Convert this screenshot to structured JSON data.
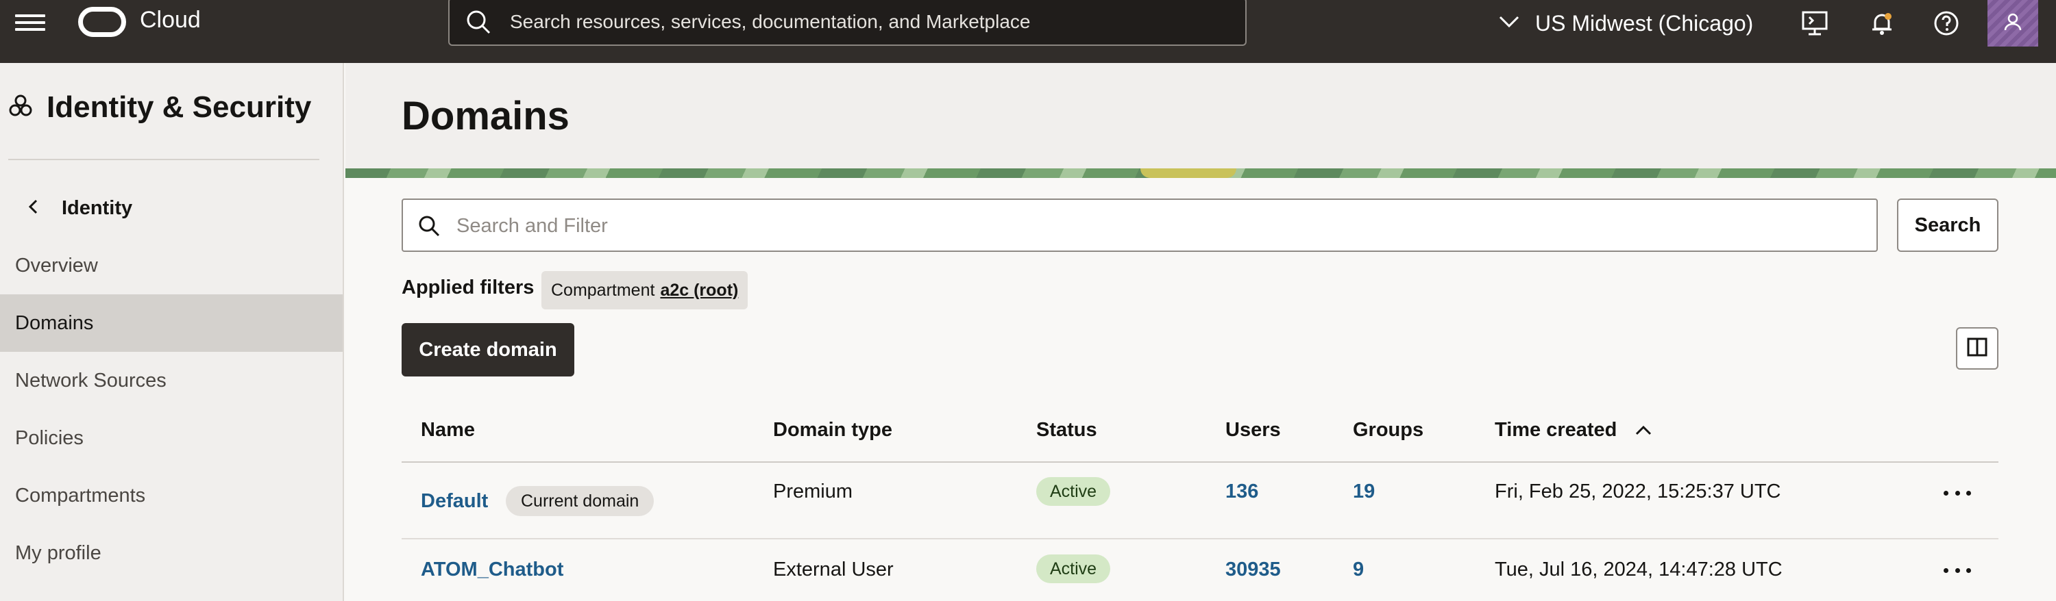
{
  "header": {
    "brand": "Cloud",
    "search_placeholder": "Search resources, services, documentation, and Marketplace",
    "region": "US Midwest (Chicago)",
    "icons": [
      "menu-icon",
      "oracle-logo",
      "search-icon",
      "chevron-down-icon",
      "cloud-shell-icon",
      "bell-icon",
      "help-icon",
      "user-icon"
    ]
  },
  "sidebar": {
    "title": "Identity & Security",
    "back_label": "Identity",
    "items": [
      {
        "label": "Overview",
        "active": false
      },
      {
        "label": "Domains",
        "active": true
      },
      {
        "label": "Network Sources",
        "active": false
      },
      {
        "label": "Policies",
        "active": false
      },
      {
        "label": "Compartments",
        "active": false
      },
      {
        "label": "My profile",
        "active": false
      }
    ]
  },
  "main": {
    "title": "Domains",
    "filter_placeholder": "Search and Filter",
    "search_button": "Search",
    "applied_filters_label": "Applied filters",
    "filter_chip": {
      "key": "Compartment",
      "value": "a2c (root)"
    },
    "create_button": "Create domain"
  },
  "table": {
    "columns": [
      "Name",
      "Domain type",
      "Status",
      "Users",
      "Groups",
      "Time created"
    ],
    "rows": [
      {
        "name": "Default",
        "tag": "Current domain",
        "type": "Premium",
        "status": "Active",
        "users": "136",
        "groups": "19",
        "created": "Fri, Feb 25, 2022, 15:25:37 UTC"
      },
      {
        "name": "ATOM_Chatbot",
        "tag": "",
        "type": "External User",
        "status": "Active",
        "users": "30935",
        "groups": "9",
        "created": "Tue, Jul 16, 2024, 14:47:28 UTC"
      }
    ]
  },
  "colors": {
    "header_bg": "#312d2a",
    "link": "#1f5c8a",
    "active_badge": "#d4e8c6",
    "sidebar_active": "#d4d1cd"
  }
}
